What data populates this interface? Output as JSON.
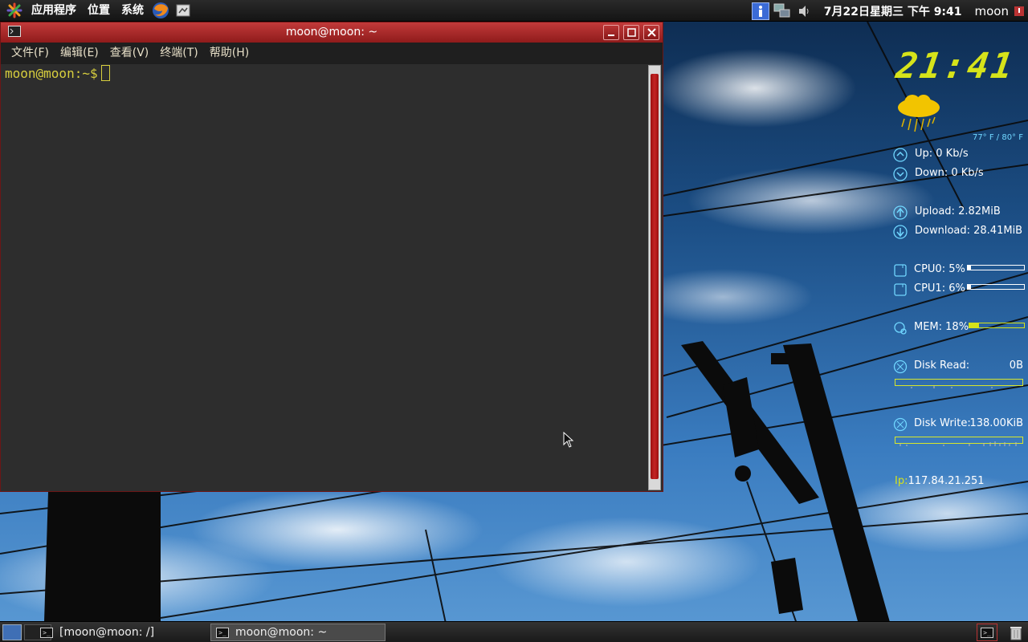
{
  "top_panel": {
    "menus": [
      "应用程序",
      "位置",
      "系统"
    ],
    "launchers": [
      "firefox-icon",
      "screenshot-icon"
    ],
    "tray_icons": [
      "info-icon",
      "network-icon",
      "volume-icon"
    ],
    "clock": "7月22日星期三 下午 9:41",
    "user": "moon"
  },
  "terminal": {
    "title": "moon@moon: ~",
    "menus": [
      "文件(F)",
      "编辑(E)",
      "查看(V)",
      "终端(T)",
      "帮助(H)"
    ],
    "prompt": "moon@moon:~$",
    "prompt_color": "#d7ce3e",
    "background": "#2d2d2d",
    "title_color": "#b52a2a"
  },
  "conky": {
    "time": "21:41",
    "weather": {
      "icon": "rain-cloud-icon",
      "temp": "77° F / 80° F"
    },
    "net_up": "Up: 0 Kb/s",
    "net_down": "Down: 0 Kb/s",
    "upload_total": "Upload: 2.82MiB",
    "download_total": "Download: 28.41MiB",
    "cpu0": {
      "label": "CPU0: 5%",
      "percent": 5
    },
    "cpu1": {
      "label": "CPU1: 6%",
      "percent": 6
    },
    "mem": {
      "label": "MEM: 18%",
      "percent": 18
    },
    "disk_read": {
      "label": "Disk Read:",
      "value": "0B"
    },
    "disk_write": {
      "label": "Disk Write:",
      "value": "138.00KiB"
    },
    "ip": {
      "label": "Ip:",
      "value": "117.84.21.251"
    },
    "accent": "#d6e31a",
    "label_color": "#ffffff"
  },
  "bottom_panel": {
    "tasks": [
      {
        "label": "[moon@moon: /]",
        "active": false
      },
      {
        "label": "moon@moon: ~",
        "active": true
      }
    ],
    "right_icons": [
      "terminal-icon",
      "trash-icon"
    ]
  }
}
